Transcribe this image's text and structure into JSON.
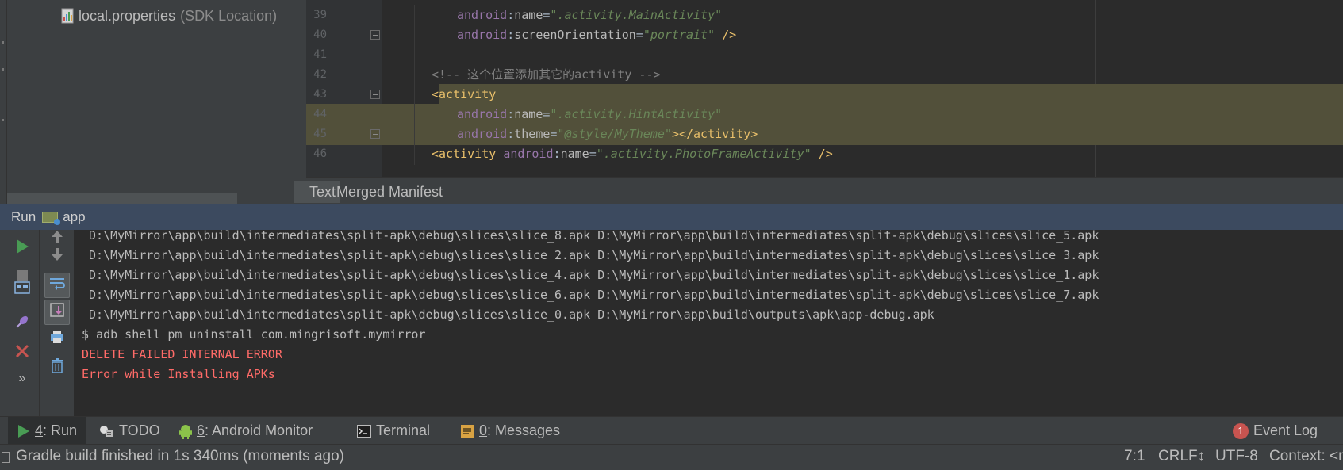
{
  "project": {
    "file_name": "local.properties",
    "file_hint": "(SDK Location)"
  },
  "editor": {
    "lines": [
      {
        "num": "39",
        "parts": [
          [
            "attr-ns",
            "android"
          ],
          [
            "plain",
            ":"
          ],
          [
            "attr",
            "name"
          ],
          [
            "plain",
            "="
          ],
          [
            "val",
            "\".activity.MainActivity\""
          ]
        ],
        "indent": 2,
        "hl": "",
        "fold": false
      },
      {
        "num": "40",
        "parts": [
          [
            "attr-ns",
            "android"
          ],
          [
            "plain",
            ":"
          ],
          [
            "attr",
            "screenOrientation"
          ],
          [
            "plain",
            "="
          ],
          [
            "val",
            "\"portrait\""
          ],
          [
            "tag",
            " />"
          ]
        ],
        "indent": 2,
        "hl": "",
        "fold": true
      },
      {
        "num": "41",
        "parts": [],
        "indent": 0,
        "hl": "",
        "fold": false
      },
      {
        "num": "42",
        "parts": [
          [
            "cmt",
            "<!-- 这个位置添加其它的activity -->"
          ]
        ],
        "indent": 1,
        "hl": "",
        "fold": false
      },
      {
        "num": "43",
        "parts": [
          [
            "tag",
            "<activity"
          ]
        ],
        "indent": 1,
        "hl": "partial",
        "fold": true
      },
      {
        "num": "44",
        "parts": [
          [
            "attr-ns",
            "android"
          ],
          [
            "plain",
            ":"
          ],
          [
            "attr",
            "name"
          ],
          [
            "plain",
            "="
          ],
          [
            "val",
            "\".activity.HintActivity\""
          ]
        ],
        "indent": 2,
        "hl": "full",
        "fold": false
      },
      {
        "num": "45",
        "parts": [
          [
            "attr-ns",
            "android"
          ],
          [
            "plain",
            ":"
          ],
          [
            "attr",
            "theme"
          ],
          [
            "plain",
            "="
          ],
          [
            "val",
            "\"@style/MyTheme\""
          ],
          [
            "tag",
            "></activity>"
          ]
        ],
        "indent": 2,
        "hl": "full",
        "fold": true
      },
      {
        "num": "46",
        "parts": [
          [
            "tag",
            "<activity "
          ],
          [
            "attr-ns",
            "android"
          ],
          [
            "plain",
            ":"
          ],
          [
            "attr",
            "name"
          ],
          [
            "plain",
            "="
          ],
          [
            "val",
            "\".activity.PhotoFrameActivity\""
          ],
          [
            "tag",
            " />"
          ]
        ],
        "indent": 1,
        "hl": "",
        "fold": false
      }
    ],
    "tabs": [
      "Text",
      "Merged Manifest"
    ],
    "active_tab": 0
  },
  "run": {
    "header_label": "Run",
    "config_name": "app",
    "console_lines": [
      {
        "text": " D:\\MyMirror\\app\\build\\intermediates\\split-apk\\debug\\slices\\slice_8.apk D:\\MyMirror\\app\\build\\intermediates\\split-apk\\debug\\slices\\slice_5.apk",
        "type": "normal"
      },
      {
        "text": " D:\\MyMirror\\app\\build\\intermediates\\split-apk\\debug\\slices\\slice_2.apk D:\\MyMirror\\app\\build\\intermediates\\split-apk\\debug\\slices\\slice_3.apk",
        "type": "normal"
      },
      {
        "text": " D:\\MyMirror\\app\\build\\intermediates\\split-apk\\debug\\slices\\slice_4.apk D:\\MyMirror\\app\\build\\intermediates\\split-apk\\debug\\slices\\slice_1.apk",
        "type": "normal"
      },
      {
        "text": " D:\\MyMirror\\app\\build\\intermediates\\split-apk\\debug\\slices\\slice_6.apk D:\\MyMirror\\app\\build\\intermediates\\split-apk\\debug\\slices\\slice_7.apk",
        "type": "normal"
      },
      {
        "text": " D:\\MyMirror\\app\\build\\intermediates\\split-apk\\debug\\slices\\slice_0.apk D:\\MyMirror\\app\\build\\outputs\\apk\\app-debug.apk",
        "type": "normal"
      },
      {
        "text": "$ adb shell pm uninstall com.mingrisoft.mymirror",
        "type": "normal"
      },
      {
        "text": "DELETE_FAILED_INTERNAL_ERROR",
        "type": "err"
      },
      {
        "text": "Error while Installing APKs",
        "type": "err"
      }
    ]
  },
  "tool_tabs": {
    "run": {
      "key": "4",
      "label": ": Run"
    },
    "todo": {
      "label": "TODO"
    },
    "android_monitor": {
      "key": "6",
      "label": ": Android Monitor"
    },
    "terminal": {
      "label": "Terminal"
    },
    "messages": {
      "key": "0",
      "label": ": Messages"
    },
    "event_log": {
      "count": "1",
      "label": "Event Log"
    }
  },
  "status": {
    "message": "Gradle build finished in 1s 340ms (moments ago)",
    "position": "7:1",
    "line_sep": "CRLF↕",
    "encoding": "UTF-8",
    "context": "Context: <n"
  },
  "colors": {
    "accent_header": "#3c4a5f",
    "error_text": "#ff6b68",
    "highlight": "#52503a",
    "run_green": "#499c54",
    "stop_red": "#c75450"
  }
}
